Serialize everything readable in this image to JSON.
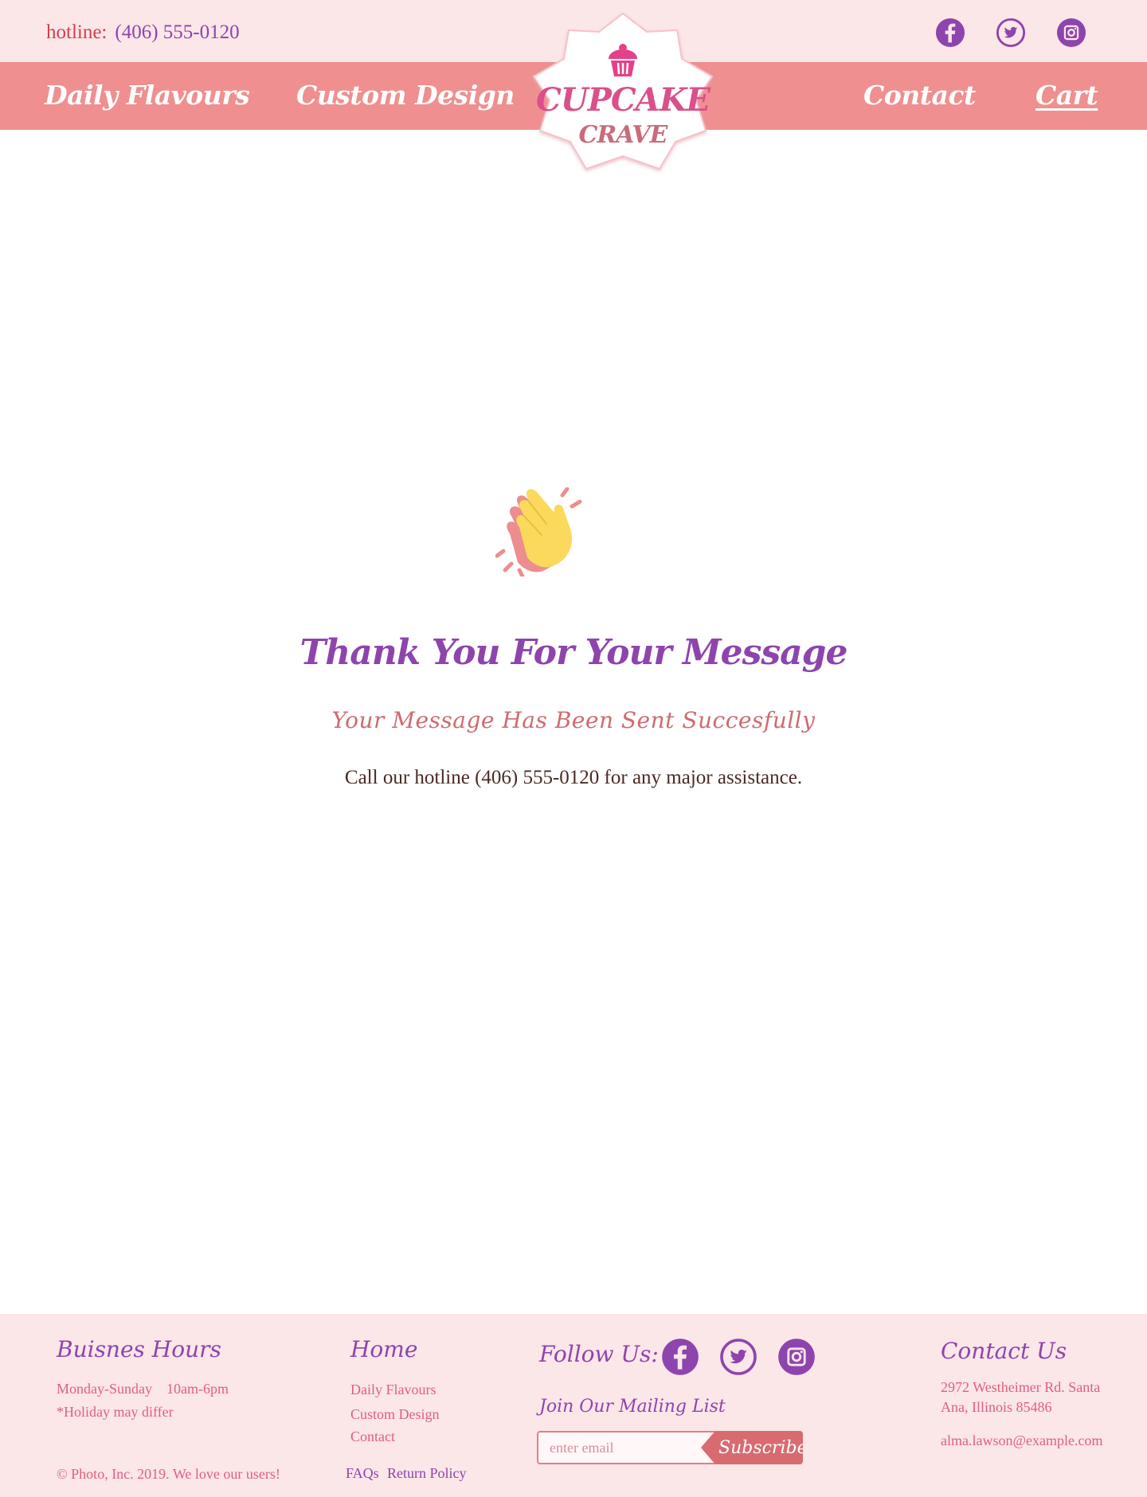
{
  "header": {
    "hotline_label": "hotline:",
    "hotline_number": "(406) 555-0120",
    "social": [
      "facebook-icon",
      "twitter-icon",
      "instagram-icon"
    ]
  },
  "nav": {
    "daily": "Daily Flavours",
    "custom": "Custom Design",
    "contact": "Contact",
    "cart": "Cart"
  },
  "logo": {
    "line1": "CUPCAKE",
    "line2": "CRAVE"
  },
  "main": {
    "icon": "clapping-hands-icon",
    "title": "Thank You For Your Message",
    "subtitle": "Your Message Has Been Sent Succesfully",
    "note": "Call our hotline (406) 555-0120 for any major assistance."
  },
  "footer": {
    "hours_heading": "Buisnes Hours",
    "hours_days": "Monday-Sunday",
    "hours_time": "10am-6pm",
    "hours_note": "*Holiday may differ",
    "copyright": "© Photo, Inc. 2019. We love our users!",
    "home_heading": "Home",
    "home_links": [
      "Daily Flavours",
      "Custom Design",
      "Contact"
    ],
    "faqs": "FAQs",
    "return_policy": "Return Policy",
    "follow_heading": "Follow Us:",
    "mailing_heading": "Join Our Mailing List",
    "email_placeholder": "enter email",
    "subscribe_label": "Subscribe",
    "contact_heading": "Contact Us",
    "address_line1": "2972 Westheimer Rd. Santa",
    "address_line2": "Ana, Illinois 85486",
    "email": "alma.lawson@example.com"
  },
  "colors": {
    "pink_band": "#ef8f8f",
    "blush_bg": "#fbe6e8",
    "purple": "#8e44ad",
    "coral": "#d06a6f",
    "logo_pink": "#d9508a"
  }
}
